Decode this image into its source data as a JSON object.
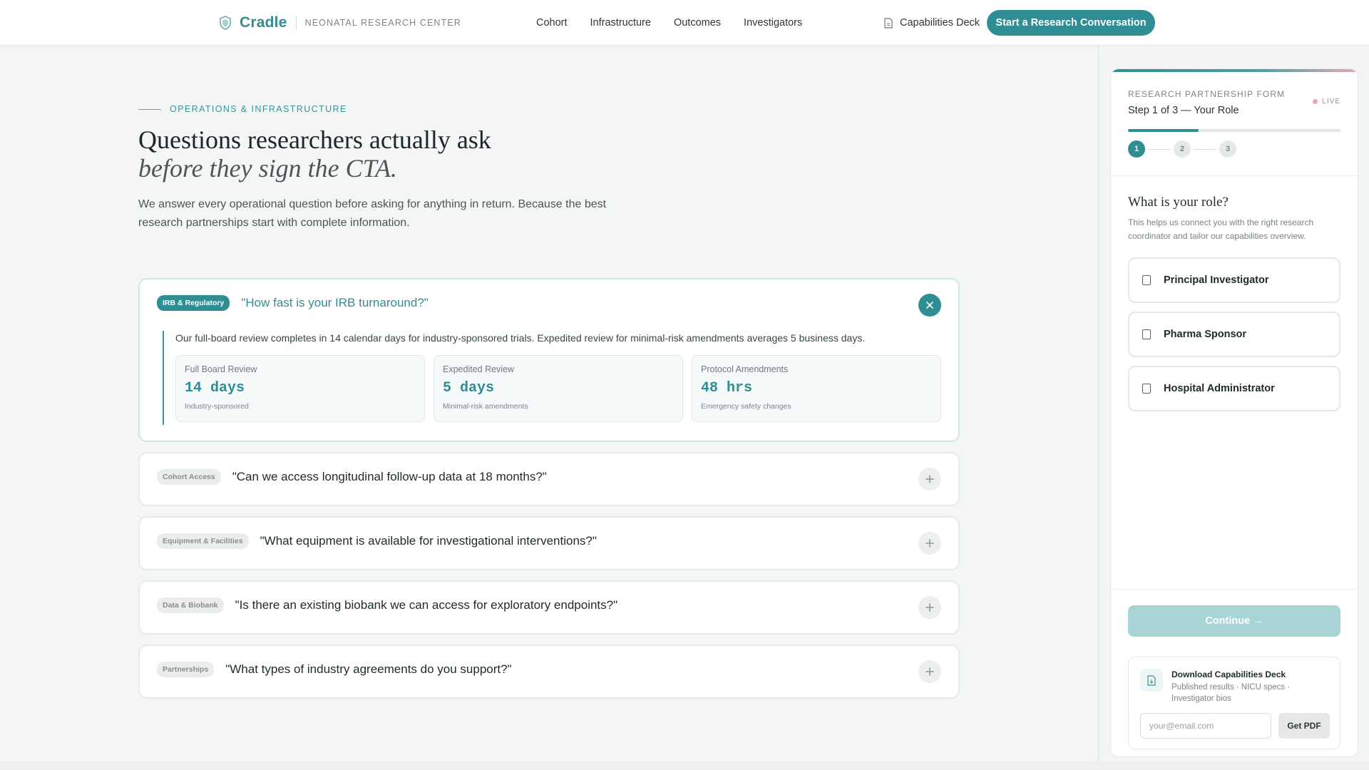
{
  "nav": {
    "brand": "Cradle",
    "brand_subtitle": "NEONATAL RESEARCH CENTER",
    "links": [
      "Cohort",
      "Infrastructure",
      "Outcomes",
      "Investigators"
    ],
    "deck_link": "Capabilities Deck",
    "cta": "Start a Research Conversation"
  },
  "hero": {
    "eyebrow": "OPERATIONS & INFRASTRUCTURE",
    "headline_line1": "Questions researchers actually ask",
    "headline_line2": "before they sign the CTA.",
    "lede": "We answer every operational question before asking for anything in return. Because the best research partnerships start with complete information."
  },
  "faq": [
    {
      "tag": "IRB & Regulatory",
      "question": "\"How fast is your IRB turnaround?\"",
      "open": true,
      "answer": "Our full-board review completes in 14 calendar days for industry-sponsored trials. Expedited review for minimal-risk amendments averages 5 business days.",
      "stats": [
        {
          "label": "Full Board Review",
          "value": "14 days",
          "note": "Industry-sponsored"
        },
        {
          "label": "Expedited Review",
          "value": "5 days",
          "note": "Minimal-risk amendments"
        },
        {
          "label": "Protocol Amendments",
          "value": "48 hrs",
          "note": "Emergency safety changes"
        }
      ]
    },
    {
      "tag": "Cohort Access",
      "question": "\"Can we access longitudinal follow-up data at 18 months?\"",
      "open": false
    },
    {
      "tag": "Equipment & Facilities",
      "question": "\"What equipment is available for investigational interventions?\"",
      "open": false
    },
    {
      "tag": "Data & Biobank",
      "question": "\"Is there an existing biobank we can access for exploratory endpoints?\"",
      "open": false
    },
    {
      "tag": "Partnerships",
      "question": "\"What types of industry agreements do you support?\"",
      "open": false
    }
  ],
  "form": {
    "kicker": "RESEARCH PARTNERSHIP FORM",
    "step_text": "Step 1 of 3 — Your Role",
    "live": "LIVE",
    "progress_fraction": 0.333,
    "steps": [
      "1",
      "2",
      "3"
    ],
    "current_step": 1,
    "question": "What is your role?",
    "help": "This helps us connect you with the right research coordinator and tailor our capabilities overview.",
    "roles": [
      "Principal Investigator",
      "Pharma Sponsor",
      "Hospital Administrator"
    ],
    "continue": "Continue →",
    "deck": {
      "title": "Download Capabilities Deck",
      "subtitle": "Published results · NICU specs · Investigator bios",
      "email_placeholder": "your@email.com",
      "button": "Get PDF"
    }
  },
  "colors": {
    "accent": "#2f8e93",
    "accent_light": "#a9d4d6",
    "live_dot": "#eaa4b6"
  },
  "icons": {
    "brand": "shield-logo-icon",
    "deck": "document-icon",
    "close": "close-icon",
    "expand": "plus-icon",
    "checkbox": "checkbox-icon"
  }
}
